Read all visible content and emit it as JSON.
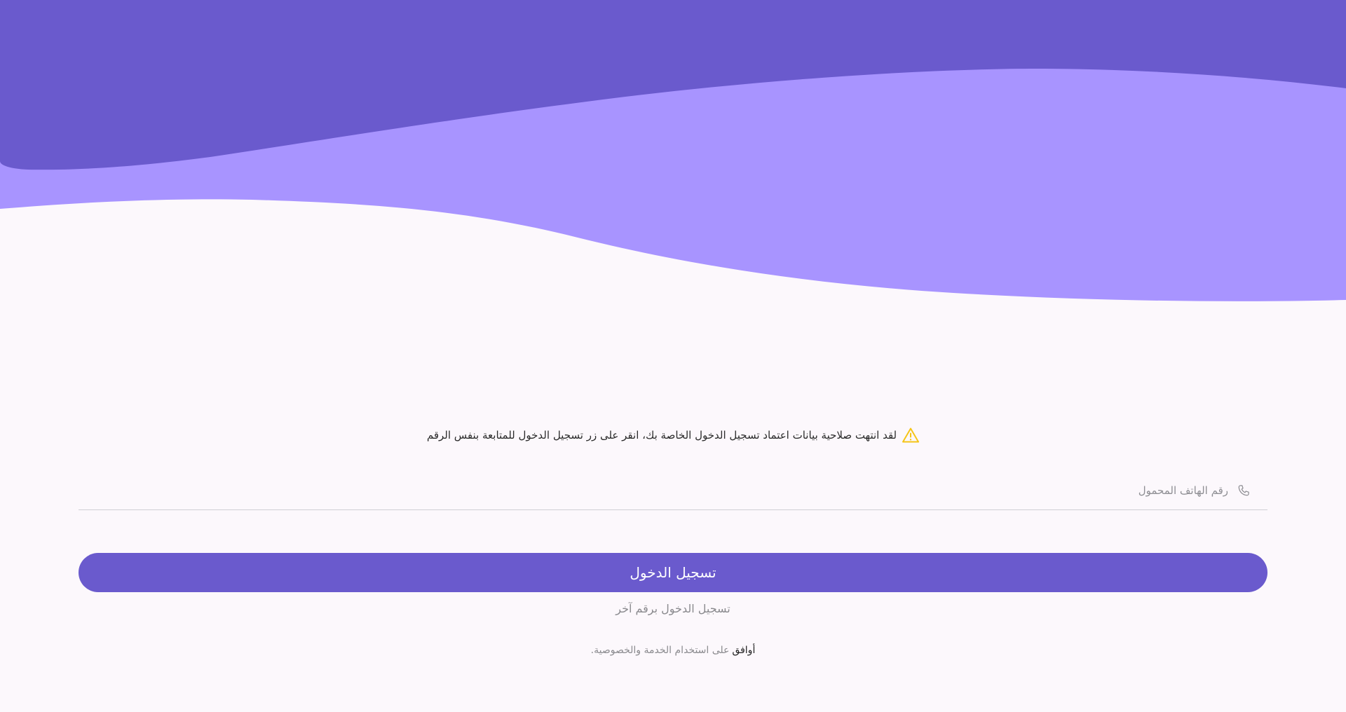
{
  "colors": {
    "wave_dark": "#6a5acd",
    "wave_light": "#a894ff",
    "background": "#fcf8fc",
    "primary_button": "#6a5acd",
    "warning_icon": "#f5c518"
  },
  "notice": {
    "icon": "warning-icon",
    "text": "لقد انتهت صلاحية بيانات اعتماد تسجيل الدخول الخاصة بك، انقر على زر تسجيل الدخول للمتابعة بنفس الرقم"
  },
  "phone": {
    "icon": "phone-icon",
    "placeholder": "رقم الهاتف المحمول",
    "value": ""
  },
  "login_button": {
    "label": "تسجيل الدخول"
  },
  "alt_login": {
    "label": "تسجيل الدخول برقم آخر"
  },
  "agreement": {
    "link": "أوافق",
    "rest": "على استخدام الخدمة والخصوصية."
  }
}
